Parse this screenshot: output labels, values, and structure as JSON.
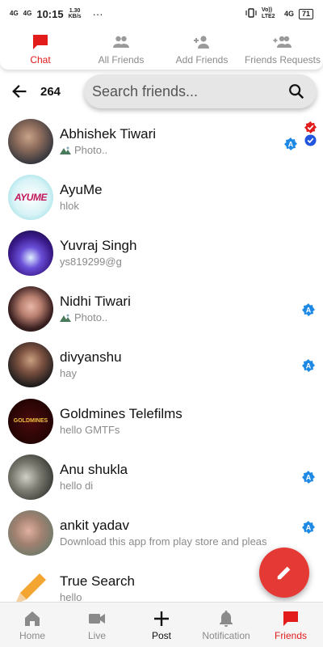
{
  "status_bar": {
    "network_left": "4G",
    "network_left2": "4G",
    "time": "10:15",
    "speed_value": "1.30",
    "speed_unit": "KB/s",
    "dots": "···",
    "volte": "Vo)) LTE2",
    "network_right": "4G",
    "battery": "71"
  },
  "top_tabs": [
    {
      "label": "Chat",
      "icon": "chat-icon",
      "active": true
    },
    {
      "label": "All Friends",
      "icon": "group-icon",
      "active": false
    },
    {
      "label": "Add Friends",
      "icon": "person-add-icon",
      "active": false
    },
    {
      "label": "Friends Requests",
      "icon": "group-add-icon",
      "active": false
    }
  ],
  "search": {
    "count": "264",
    "placeholder": "Search friends..."
  },
  "friends": [
    {
      "name": "Abhishek Tiwari",
      "message": "Photo..",
      "has_photo_icon": true,
      "badge_a": true,
      "verified": true
    },
    {
      "name": "AyuMe",
      "message": "hlok",
      "avatar_text": "AYUME"
    },
    {
      "name": "Yuvraj Singh",
      "message": "ys819299@g"
    },
    {
      "name": "Nidhi Tiwari",
      "message": "Photo..",
      "has_photo_icon": true,
      "badge_a": true
    },
    {
      "name": "divyanshu",
      "message": "hay",
      "badge_a": true
    },
    {
      "name": "Goldmines Telefilms",
      "message": "hello GMTFs",
      "avatar_text": "GOLDMINES"
    },
    {
      "name": "Anu shukla",
      "message": "hello di",
      "badge_a": true
    },
    {
      "name": "ankit yadav",
      "message": "Download this app from play store and pleas",
      "badge_a": true
    },
    {
      "name": "True Search",
      "message": "hello"
    }
  ],
  "bottom_nav": [
    {
      "label": "Home",
      "icon": "home-icon"
    },
    {
      "label": "Live",
      "icon": "video-icon"
    },
    {
      "label": "Post",
      "icon": "plus-icon"
    },
    {
      "label": "Notification",
      "icon": "bell-icon"
    },
    {
      "label": "Friends",
      "icon": "chat-icon"
    }
  ],
  "colors": {
    "accent": "#e21b1b",
    "badge_blue": "#1e88e5",
    "fab": "#e53935"
  }
}
